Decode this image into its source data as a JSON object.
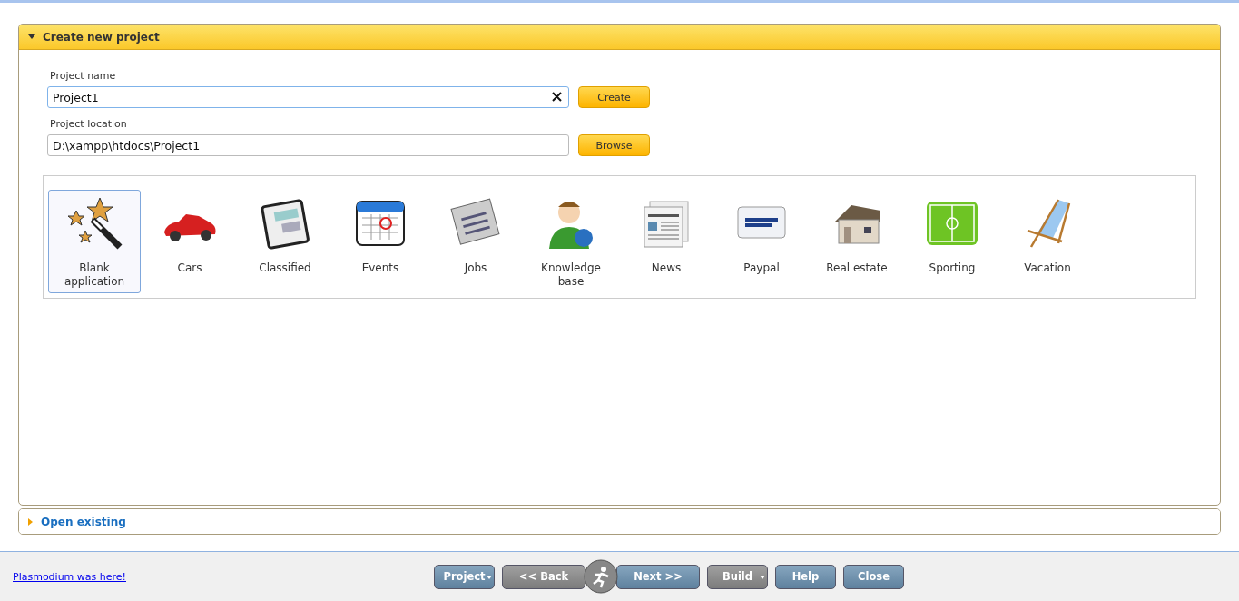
{
  "create_section": {
    "title": "Create new project",
    "expanded": true,
    "fields": [
      {
        "label": "Project name",
        "value": "Project1",
        "clearable": true,
        "focused": true,
        "button": "Create"
      },
      {
        "label": "Project location",
        "value": "D:\\xampp\\htdocs\\Project1",
        "clearable": false,
        "focused": false,
        "button": "Browse"
      }
    ],
    "templates": [
      {
        "label": "Blank application",
        "kind": "wand",
        "selected": true
      },
      {
        "label": "Cars",
        "kind": "car",
        "selected": false
      },
      {
        "label": "Classified",
        "kind": "paper",
        "selected": false
      },
      {
        "label": "Events",
        "kind": "calendar",
        "selected": false
      },
      {
        "label": "Jobs",
        "kind": "jobs",
        "selected": false
      },
      {
        "label": "Knowledge base",
        "kind": "person",
        "selected": false
      },
      {
        "label": "News",
        "kind": "news",
        "selected": false
      },
      {
        "label": "Paypal",
        "kind": "paypal",
        "selected": false
      },
      {
        "label": "Real estate",
        "kind": "house",
        "selected": false
      },
      {
        "label": "Sporting",
        "kind": "field",
        "selected": false
      },
      {
        "label": "Vacation",
        "kind": "chair",
        "selected": false
      }
    ]
  },
  "open_section": {
    "title": "Open existing",
    "expanded": false
  },
  "footer": {
    "link": "Plasmodium was here!",
    "buttons": [
      {
        "label": "Project",
        "kind": "dropdown",
        "disabled": false
      },
      {
        "label": "<< Back",
        "kind": "back",
        "disabled": true
      },
      {
        "label": "Next >>",
        "kind": "next",
        "disabled": false
      },
      {
        "label": "Build",
        "kind": "dropdown",
        "disabled": true
      },
      {
        "label": "Help",
        "kind": "plain",
        "disabled": false
      },
      {
        "label": "Close",
        "kind": "plain",
        "disabled": false
      }
    ]
  }
}
